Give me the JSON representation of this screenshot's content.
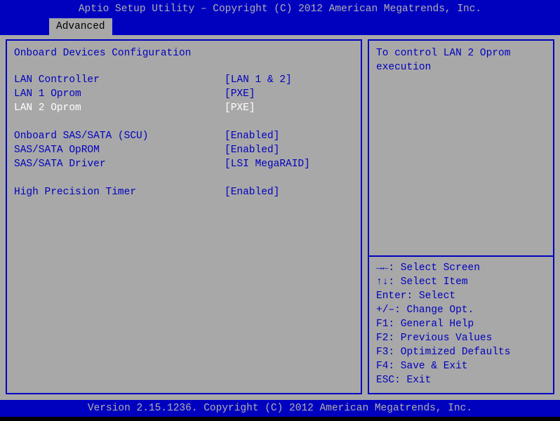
{
  "titlebar": "Aptio Setup Utility – Copyright (C) 2012 American Megatrends, Inc.",
  "tab": {
    "advanced": "Advanced"
  },
  "section_title": "Onboard Devices Configuration",
  "settings": {
    "group1": [
      {
        "label": "LAN Controller",
        "value": "[LAN 1 & 2]",
        "selected": false
      },
      {
        "label": "LAN 1 Oprom",
        "value": "[PXE]",
        "selected": false
      },
      {
        "label": "LAN 2 Oprom",
        "value": "[PXE]",
        "selected": true
      }
    ],
    "group2": [
      {
        "label": "Onboard SAS/SATA (SCU)",
        "value": "[Enabled]",
        "selected": false
      },
      {
        "label": "SAS/SATA OpROM",
        "value": "[Enabled]",
        "selected": false
      },
      {
        "label": "SAS/SATA Driver",
        "value": "[LSI MegaRAID]",
        "selected": false
      }
    ],
    "group3": [
      {
        "label": "High Precision Timer",
        "value": "[Enabled]",
        "selected": false
      }
    ]
  },
  "help_text": "To control LAN 2 Oprom\nexecution",
  "keys": [
    "><: Select Screen",
    "^v: Select Item",
    "Enter: Select",
    "+/–: Change Opt.",
    "F1: General Help",
    "F2: Previous Values",
    "F3: Optimized Defaults",
    "F4: Save & Exit",
    "ESC: Exit"
  ],
  "key_symbols": {
    "lr": "→←",
    "ud": "↑↓"
  },
  "footer": "Version 2.15.1236. Copyright (C) 2012 American Megatrends, Inc."
}
